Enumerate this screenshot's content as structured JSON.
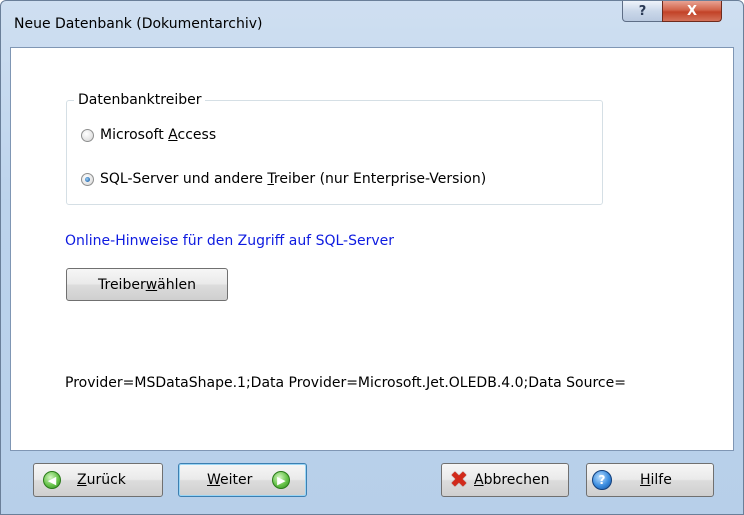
{
  "window": {
    "title": "Neue Datenbank (Dokumentarchiv)",
    "help_glyph": "?",
    "close_glyph": "X"
  },
  "driver_group": {
    "legend": "Datenbanktreiber",
    "options": [
      {
        "pre": "Microsoft ",
        "accel": "A",
        "post": "ccess",
        "checked": false
      },
      {
        "pre": "SQL-Server und andere ",
        "accel": "T",
        "post": "reiber (nur Enterprise-Version)",
        "checked": true
      }
    ]
  },
  "online_link": "Online-Hinweise für den Zugriff auf SQL-Server",
  "driver_button": {
    "pre": "Treiber ",
    "accel": "w",
    "post": "ählen"
  },
  "provider_string": "Provider=MSDataShape.1;Data Provider=Microsoft.Jet.OLEDB.4.0;Data Source=",
  "buttons": {
    "back": {
      "accel": "Z",
      "post": "urück",
      "icon": "arrow-left-icon"
    },
    "next": {
      "accel": "W",
      "post": "eiter",
      "icon": "arrow-right-icon"
    },
    "cancel": {
      "accel": "A",
      "post": "bbrechen",
      "icon": "cancel-x-icon"
    },
    "help": {
      "accel": "H",
      "post": "ilfe",
      "icon": "help-icon"
    }
  },
  "colors": {
    "link": "#0e1be0",
    "frame": "#bcd3ec",
    "close_button": "#c24227"
  }
}
